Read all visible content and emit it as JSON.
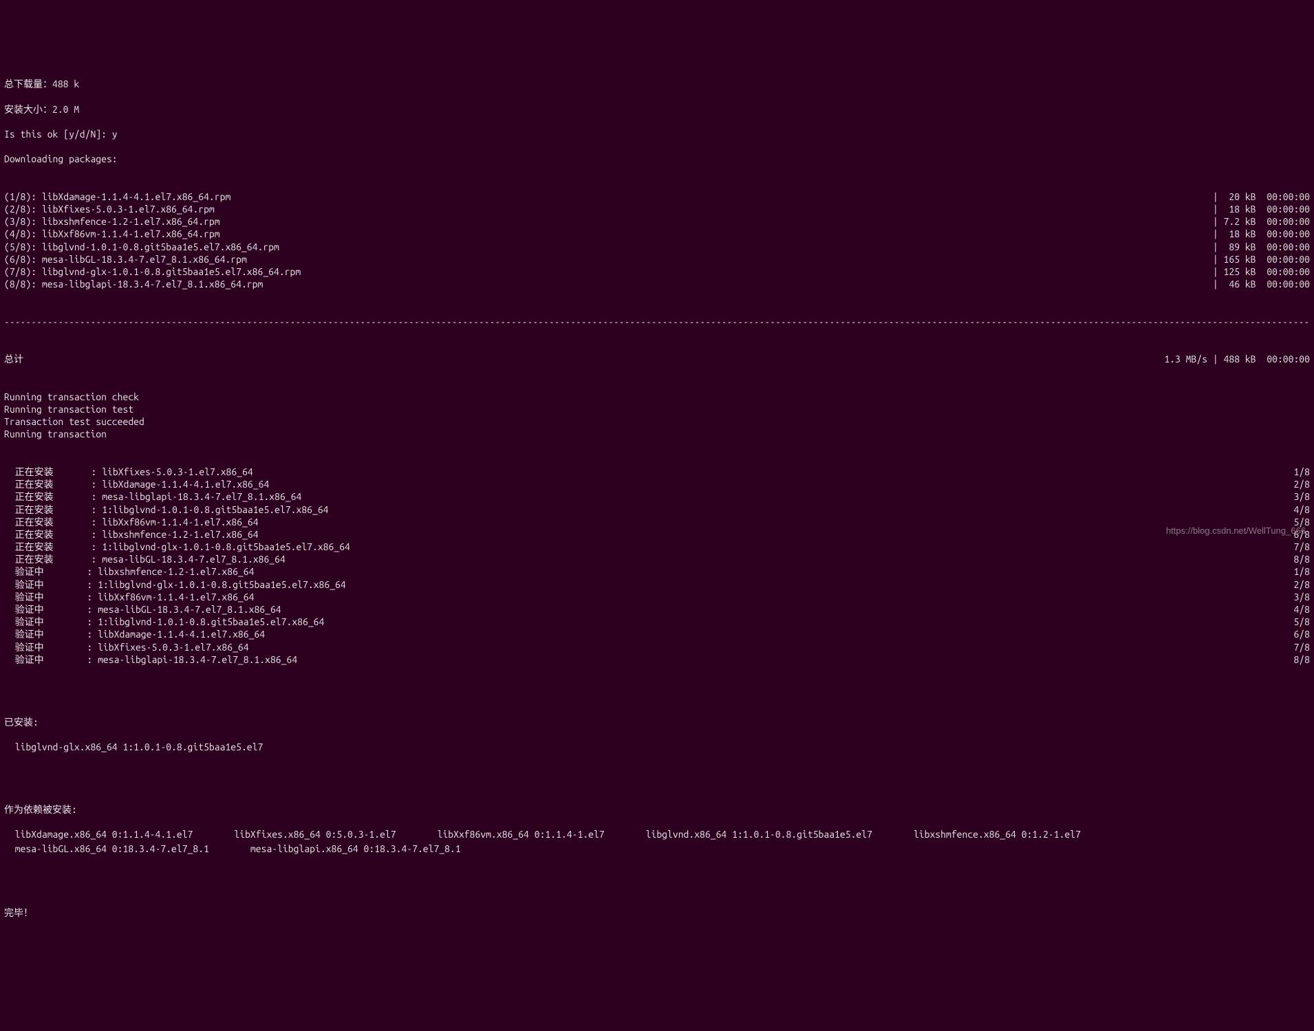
{
  "headers": {
    "total_download_label": "总下载量：",
    "total_download_value": "488 k",
    "install_size_label": "安装大小：",
    "install_size_value": "2.0 M",
    "confirm_prompt": "Is this ok [y/d/N]: y",
    "downloading": "Downloading packages:"
  },
  "packages": [
    {
      "left": "(1/8): libXdamage-1.1.4-4.1.el7.x86_64.rpm",
      "right": "|  20 kB  00:00:00"
    },
    {
      "left": "(2/8): libXfixes-5.0.3-1.el7.x86_64.rpm",
      "right": "|  18 kB  00:00:00"
    },
    {
      "left": "(3/8): libxshmfence-1.2-1.el7.x86_64.rpm",
      "right": "| 7.2 kB  00:00:00"
    },
    {
      "left": "(4/8): libXxf86vm-1.1.4-1.el7.x86_64.rpm",
      "right": "|  18 kB  00:00:00"
    },
    {
      "left": "(5/8): libglvnd-1.0.1-0.8.git5baa1e5.el7.x86_64.rpm",
      "right": "|  89 kB  00:00:00"
    },
    {
      "left": "(6/8): mesa-libGL-18.3.4-7.el7_8.1.x86_64.rpm",
      "right": "| 165 kB  00:00:00"
    },
    {
      "left": "(7/8): libglvnd-glx-1.0.1-0.8.git5baa1e5.el7.x86_64.rpm",
      "right": "| 125 kB  00:00:00"
    },
    {
      "left": "(8/8): mesa-libglapi-18.3.4-7.el7_8.1.x86_64.rpm",
      "right": "|  46 kB  00:00:00"
    }
  ],
  "totals": {
    "left": "总计",
    "right": "1.3 MB/s | 488 kB  00:00:00"
  },
  "transaction_lines": [
    "Running transaction check",
    "Running transaction test",
    "Transaction test succeeded",
    "Running transaction"
  ],
  "install_steps": [
    {
      "action": "正在安装",
      "pkg": "libXfixes-5.0.3-1.el7.x86_64",
      "count": "1/8"
    },
    {
      "action": "正在安装",
      "pkg": "libXdamage-1.1.4-4.1.el7.x86_64",
      "count": "2/8"
    },
    {
      "action": "正在安装",
      "pkg": "mesa-libglapi-18.3.4-7.el7_8.1.x86_64",
      "count": "3/8"
    },
    {
      "action": "正在安装",
      "pkg": "1:libglvnd-1.0.1-0.8.git5baa1e5.el7.x86_64",
      "count": "4/8"
    },
    {
      "action": "正在安装",
      "pkg": "libXxf86vm-1.1.4-1.el7.x86_64",
      "count": "5/8"
    },
    {
      "action": "正在安装",
      "pkg": "libxshmfence-1.2-1.el7.x86_64",
      "count": "6/8"
    },
    {
      "action": "正在安装",
      "pkg": "1:libglvnd-glx-1.0.1-0.8.git5baa1e5.el7.x86_64",
      "count": "7/8"
    },
    {
      "action": "正在安装",
      "pkg": "mesa-libGL-18.3.4-7.el7_8.1.x86_64",
      "count": "8/8"
    },
    {
      "action": "验证中",
      "pkg": "libxshmfence-1.2-1.el7.x86_64",
      "count": "1/8"
    },
    {
      "action": "验证中",
      "pkg": "1:libglvnd-glx-1.0.1-0.8.git5baa1e5.el7.x86_64",
      "count": "2/8"
    },
    {
      "action": "验证中",
      "pkg": "libXxf86vm-1.1.4-1.el7.x86_64",
      "count": "3/8"
    },
    {
      "action": "验证中",
      "pkg": "mesa-libGL-18.3.4-7.el7_8.1.x86_64",
      "count": "4/8"
    },
    {
      "action": "验证中",
      "pkg": "1:libglvnd-1.0.1-0.8.git5baa1e5.el7.x86_64",
      "count": "5/8"
    },
    {
      "action": "验证中",
      "pkg": "libXdamage-1.1.4-4.1.el7.x86_64",
      "count": "6/8"
    },
    {
      "action": "验证中",
      "pkg": "libXfixes-5.0.3-1.el7.x86_64",
      "count": "7/8"
    },
    {
      "action": "验证中",
      "pkg": "mesa-libglapi-18.3.4-7.el7_8.1.x86_64",
      "count": "8/8"
    }
  ],
  "installed_header": "已安装:",
  "installed_line": "  libglvnd-glx.x86_64 1:1.0.1-0.8.git5baa1e5.el7",
  "deps_header": "作为依赖被安装:",
  "deps": [
    "  libXdamage.x86_64 0:1.1.4-4.1.el7",
    "libXfixes.x86_64 0:5.0.3-1.el7",
    "libXxf86vm.x86_64 0:1.1.4-1.el7",
    "libglvnd.x86_64 1:1.0.1-0.8.git5baa1e5.el7",
    "libxshmfence.x86_64 0:1.2-1.el7",
    "  mesa-libGL.x86_64 0:18.3.4-7.el7_8.1",
    "mesa-libglapi.x86_64 0:18.3.4-7.el7_8.1"
  ],
  "done": "完毕！",
  "watermark": "https://blog.csdn.net/WellTung_666"
}
